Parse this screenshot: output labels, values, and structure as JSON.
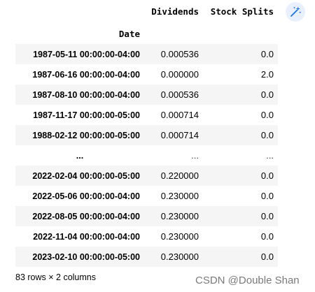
{
  "header": {
    "index_name": "Date",
    "columns": [
      "Dividends",
      "Stock Splits"
    ]
  },
  "rows": [
    {
      "date": "1987-05-11 00:00:00-04:00",
      "dividends": "0.000536",
      "splits": "0.0"
    },
    {
      "date": "1987-06-16 00:00:00-04:00",
      "dividends": "0.000000",
      "splits": "2.0"
    },
    {
      "date": "1987-08-10 00:00:00-04:00",
      "dividends": "0.000536",
      "splits": "0.0"
    },
    {
      "date": "1987-11-17 00:00:00-05:00",
      "dividends": "0.000714",
      "splits": "0.0"
    },
    {
      "date": "1988-02-12 00:00:00-05:00",
      "dividends": "0.000714",
      "splits": "0.0"
    },
    {
      "date": "...",
      "dividends": "...",
      "splits": "..."
    },
    {
      "date": "2022-02-04 00:00:00-05:00",
      "dividends": "0.220000",
      "splits": "0.0"
    },
    {
      "date": "2022-05-06 00:00:00-04:00",
      "dividends": "0.230000",
      "splits": "0.0"
    },
    {
      "date": "2022-08-05 00:00:00-04:00",
      "dividends": "0.230000",
      "splits": "0.0"
    },
    {
      "date": "2022-11-04 00:00:00-04:00",
      "dividends": "0.230000",
      "splits": "0.0"
    },
    {
      "date": "2023-02-10 00:00:00-05:00",
      "dividends": "0.230000",
      "splits": "0.0"
    }
  ],
  "caption": "83 rows × 2 columns",
  "watermark": "CSDN @Double Shan",
  "icons": {
    "magic_button": "magic-wand-icon"
  },
  "colors": {
    "row_shade": "#f5f5f5",
    "button_bg": "#e8f0fe",
    "icon_blue": "#1a73e8"
  }
}
